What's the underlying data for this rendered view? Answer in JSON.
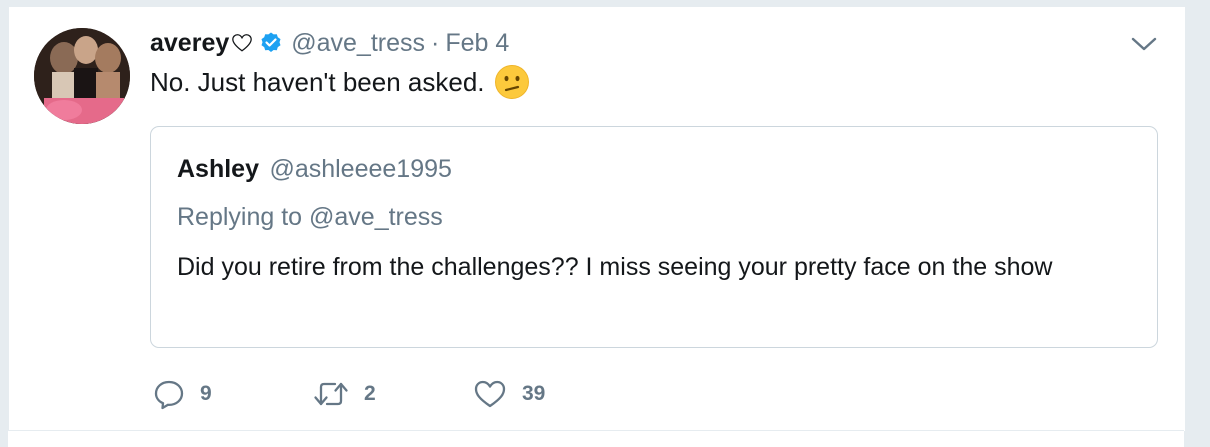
{
  "tweet": {
    "display_name": "averey",
    "handle": "@ave_tress",
    "separator": "·",
    "date": "Feb 4",
    "text": "No. Just haven't been asked.",
    "emoji": "confused-face-emoji"
  },
  "quoted_tweet": {
    "display_name": "Ashley",
    "handle": "@ashleeee1995",
    "replying_to": "Replying to @ave_tress",
    "text": "Did you retire from the challenges?? I miss seeing your pretty face on the show"
  },
  "actions": {
    "reply_count": "9",
    "retweet_count": "2",
    "like_count": "39"
  },
  "icons": [
    "heart-outline-icon",
    "verified-badge-icon",
    "chevron-down-icon",
    "reply-icon",
    "retweet-icon",
    "like-icon"
  ],
  "colors": {
    "text": "#14171a",
    "muted": "#657786",
    "verified": "#1da1f2",
    "border": "#ccd6dd",
    "background": "#e6ecf0"
  }
}
